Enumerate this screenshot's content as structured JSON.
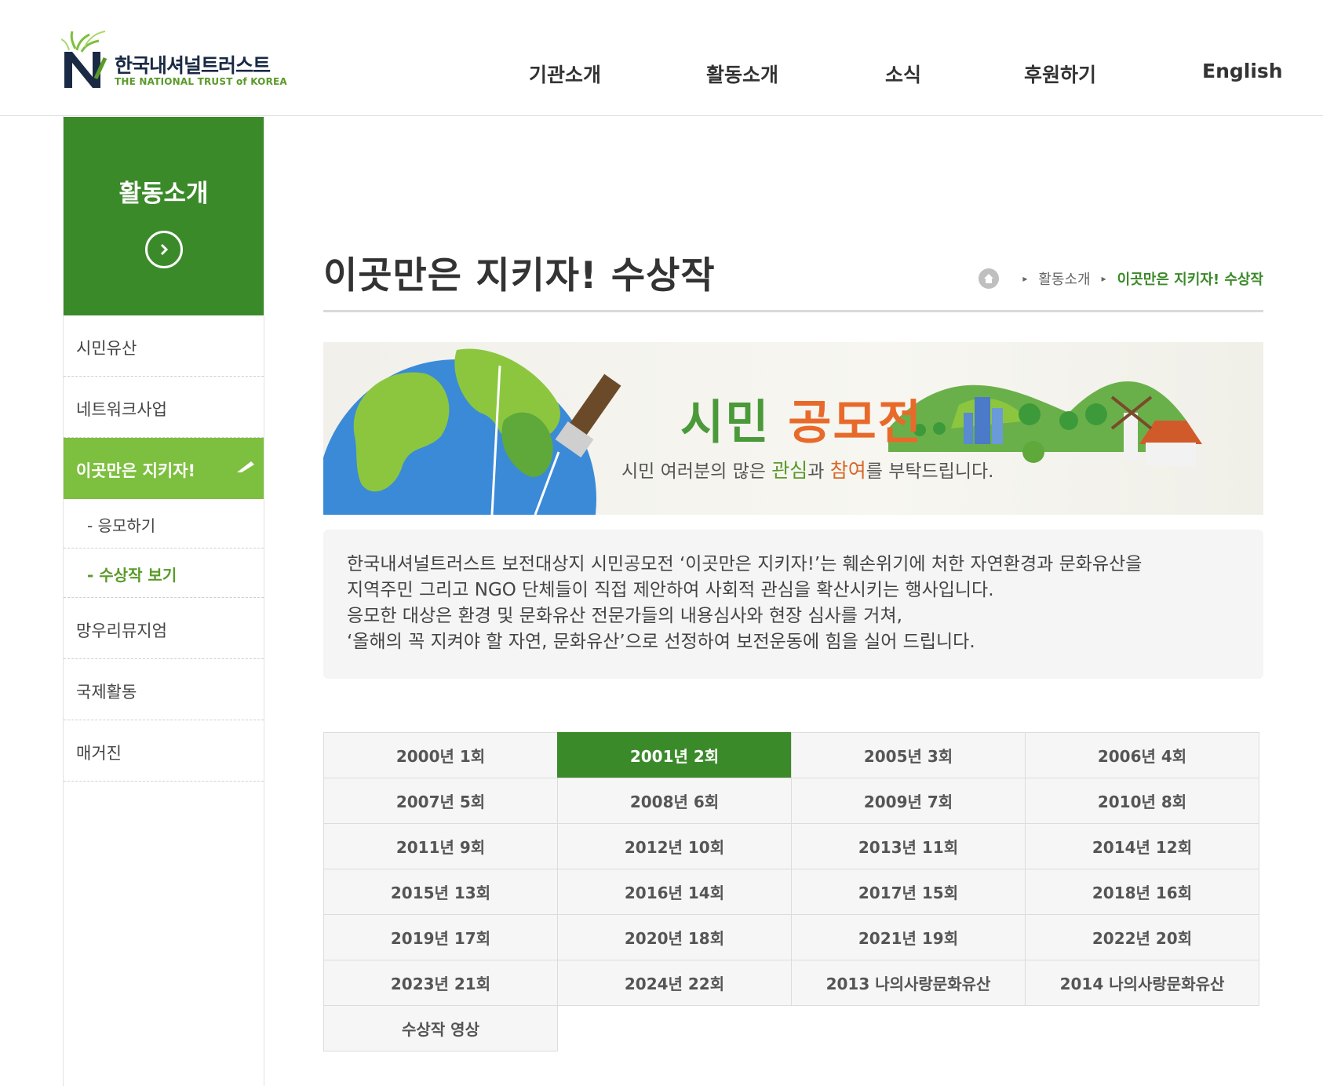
{
  "header": {
    "logo_ko": "한국내셔널트러스트",
    "logo_en": "THE NATIONAL TRUST of KOREA",
    "nav": [
      "기관소개",
      "활동소개",
      "소식",
      "후원하기",
      "English"
    ]
  },
  "sidebar": {
    "title": "활동소개",
    "items": {
      "civic": "시민유산",
      "network": "네트워크사업",
      "protect": "이곳만은 지키자!",
      "sub_apply": "- 응모하기",
      "sub_awards": "- 수상작 보기",
      "museum": "망우리뮤지엄",
      "intl": "국제활동",
      "magazine": "매거진"
    }
  },
  "main": {
    "title": "이곳만은 지키자! 수상작",
    "breadcrumb": [
      "활동소개",
      "이곳만은 지키자! 수상작"
    ],
    "banner": {
      "title_a": "시민 ",
      "title_b": "공모전",
      "sub_1": "시민 여러분의 많은 ",
      "sub_2": "관심",
      "sub_3": "과 ",
      "sub_4": "참여",
      "sub_5": "를 부탁드립니다."
    },
    "intro": [
      "한국내셔널트러스트 보전대상지 시민공모전 ‘이곳만은 지키자!’는 훼손위기에 처한 자연환경과 문화유산을",
      "지역주민 그리고 NGO 단체들이 직접 제안하여 사회적 관심을 확산시키는 행사입니다.",
      "응모한 대상은 환경 및 문화유산 전문가들의 내용심사와 현장 심사를 거쳐,",
      "‘올해의 꼭 지켜야 할 자연, 문화유산’으로 선정하여 보전운동에 힘을 실어 드립니다."
    ],
    "years": [
      "2000년 1회",
      "2001년 2회",
      "2005년 3회",
      "2006년 4회",
      "2007년 5회",
      "2008년 6회",
      "2009년 7회",
      "2010년 8회",
      "2011년 9회",
      "2012년 10회",
      "2013년 11회",
      "2014년 12회",
      "2015년 13회",
      "2016년 14회",
      "2017년 15회",
      "2018년 16회",
      "2019년 17회",
      "2020년 18회",
      "2021년 19회",
      "2022년 20회",
      "2023년 21회",
      "2024년 22회",
      "2013 나의사랑문화유산",
      "2014 나의사랑문화유산",
      "수상작 영상"
    ],
    "selected_year": "2001년 2회"
  },
  "colors": {
    "brand_green": "#3b8a2a",
    "light_green": "#7dbf3f",
    "orange": "#e86a2a"
  }
}
